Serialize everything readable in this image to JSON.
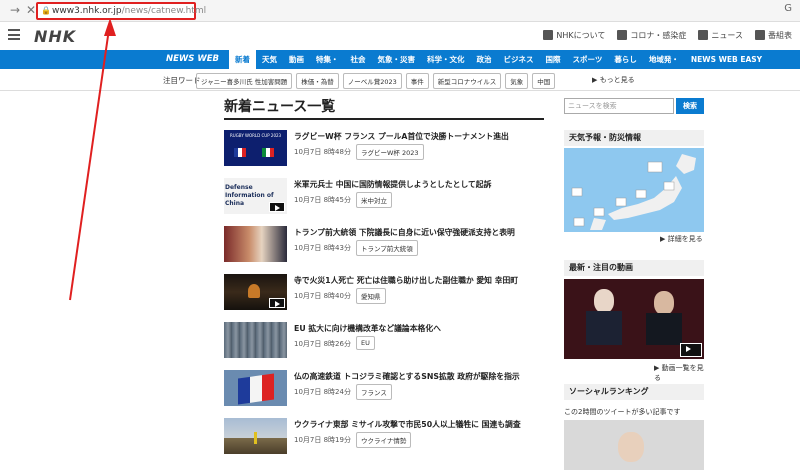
{
  "browser": {
    "url_host": "www3.nhk.or.jp",
    "url_path": "/news/catnew.html",
    "back_glyph": "→",
    "close_glyph": "✕",
    "right_glyph": "G"
  },
  "header": {
    "logo": "NHK",
    "links": [
      "NHKについて",
      "コロナ・感染症",
      "ニュース",
      "番組表"
    ]
  },
  "nav": {
    "brand": "NEWS WEB",
    "items": [
      "新着",
      "天気",
      "動画",
      "特集・",
      "社会",
      "気象・災害",
      "科学・文化",
      "政治",
      "ビジネス",
      "国際",
      "スポーツ",
      "暮らし",
      "地域発・",
      "NEWS WEB EASY"
    ]
  },
  "tagsbar": {
    "label": "注目ワード",
    "tags": [
      "ジャニー喜多川氏 性加害問題",
      "株価・為替",
      "ノーベル賞2023",
      "事件",
      "新型コロナウイルス",
      "気象",
      "中国"
    ],
    "more": "▶ もっと見る"
  },
  "main": {
    "title": "新着ニュース一覧",
    "articles": [
      {
        "title": "ラグビーW杯 フランス プールA首位で決勝トーナメント進出",
        "time": "10月7日 8時48分",
        "tag": "ラグビーW杯 2023"
      },
      {
        "title": "米軍元兵士 中国に国防情報提供しようとしたとして起訴",
        "time": "10月7日 8時45分",
        "tag": "米中対立"
      },
      {
        "title": "トランプ前大統領 下院議長に自身に近い保守強硬派支持と表明",
        "time": "10月7日 8時43分",
        "tag": "トランプ前大統領"
      },
      {
        "title": "寺で火災1人死亡 死亡は住職ら助け出した副住職か 愛知 幸田町",
        "time": "10月7日 8時40分",
        "tag": "愛知県"
      },
      {
        "title": "EU 拡大に向け機構改革など議論本格化へ",
        "time": "10月7日 8時26分",
        "tag": "EU"
      },
      {
        "title": "仏の高速鉄道 トコジラミ確認とするSNS拡散 政府が駆除を指示",
        "time": "10月7日 8時24分",
        "tag": "フランス"
      },
      {
        "title": "ウクライナ東部 ミサイル攻撃で市民50人以上犠牲に 国連も調査",
        "time": "10月7日 8時19分",
        "tag": "ウクライナ情勢"
      }
    ],
    "thumb_texts": [
      "RUGBY WORLD CUP 2023",
      "Defense Information of China"
    ]
  },
  "side": {
    "search_placeholder": "ニュースを検索",
    "search_button": "検索",
    "weather_title": "天気予報・防災情報",
    "weather_more": "▶ 詳細を見る",
    "video_title": "最新・注目の動画",
    "video_more": "▶ 動画一覧を見る",
    "ranking_title": "ソーシャルランキング",
    "ranking_subtitle": "この2時間のツイートが多い記事です"
  }
}
